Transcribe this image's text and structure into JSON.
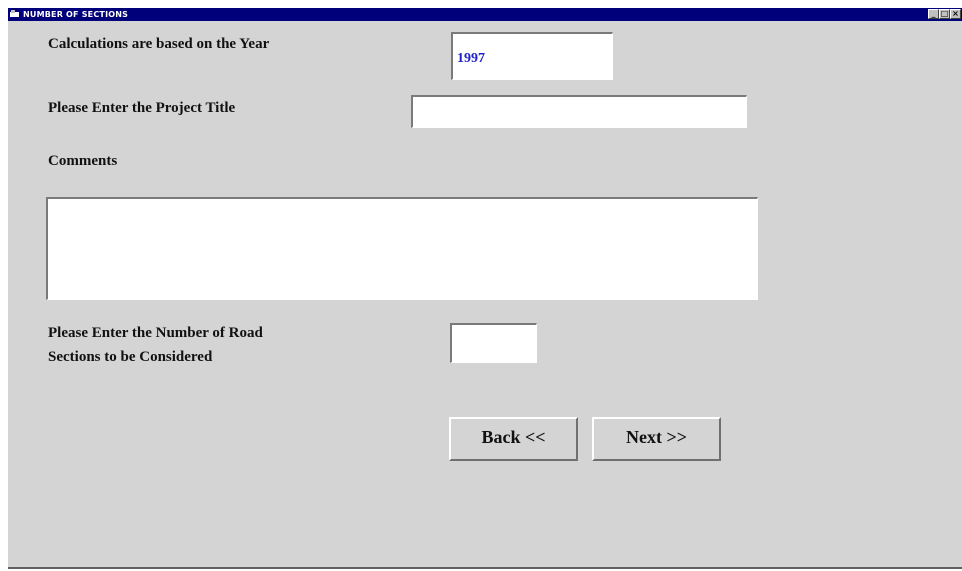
{
  "window": {
    "title": "NUMBER OF SECTIONS",
    "controls": {
      "minimize": "_",
      "maximize": "□",
      "close": "×"
    }
  },
  "form": {
    "year_label": "Calculations are based on the Year",
    "year_value": "1997",
    "project_title_label": "Please Enter the Project Title",
    "project_title_value": "",
    "comments_label": "Comments",
    "comments_value": "",
    "road_sections_label_line1": "Please Enter the Number of Road",
    "road_sections_label_line2": "Sections to be Considered",
    "road_sections_value": ""
  },
  "buttons": {
    "back_label": "Back <<",
    "next_label": "Next >>"
  },
  "colors": {
    "titlebar": "#00007a",
    "client_background": "#d4d4d4",
    "year_value_text": "#2020c8"
  }
}
